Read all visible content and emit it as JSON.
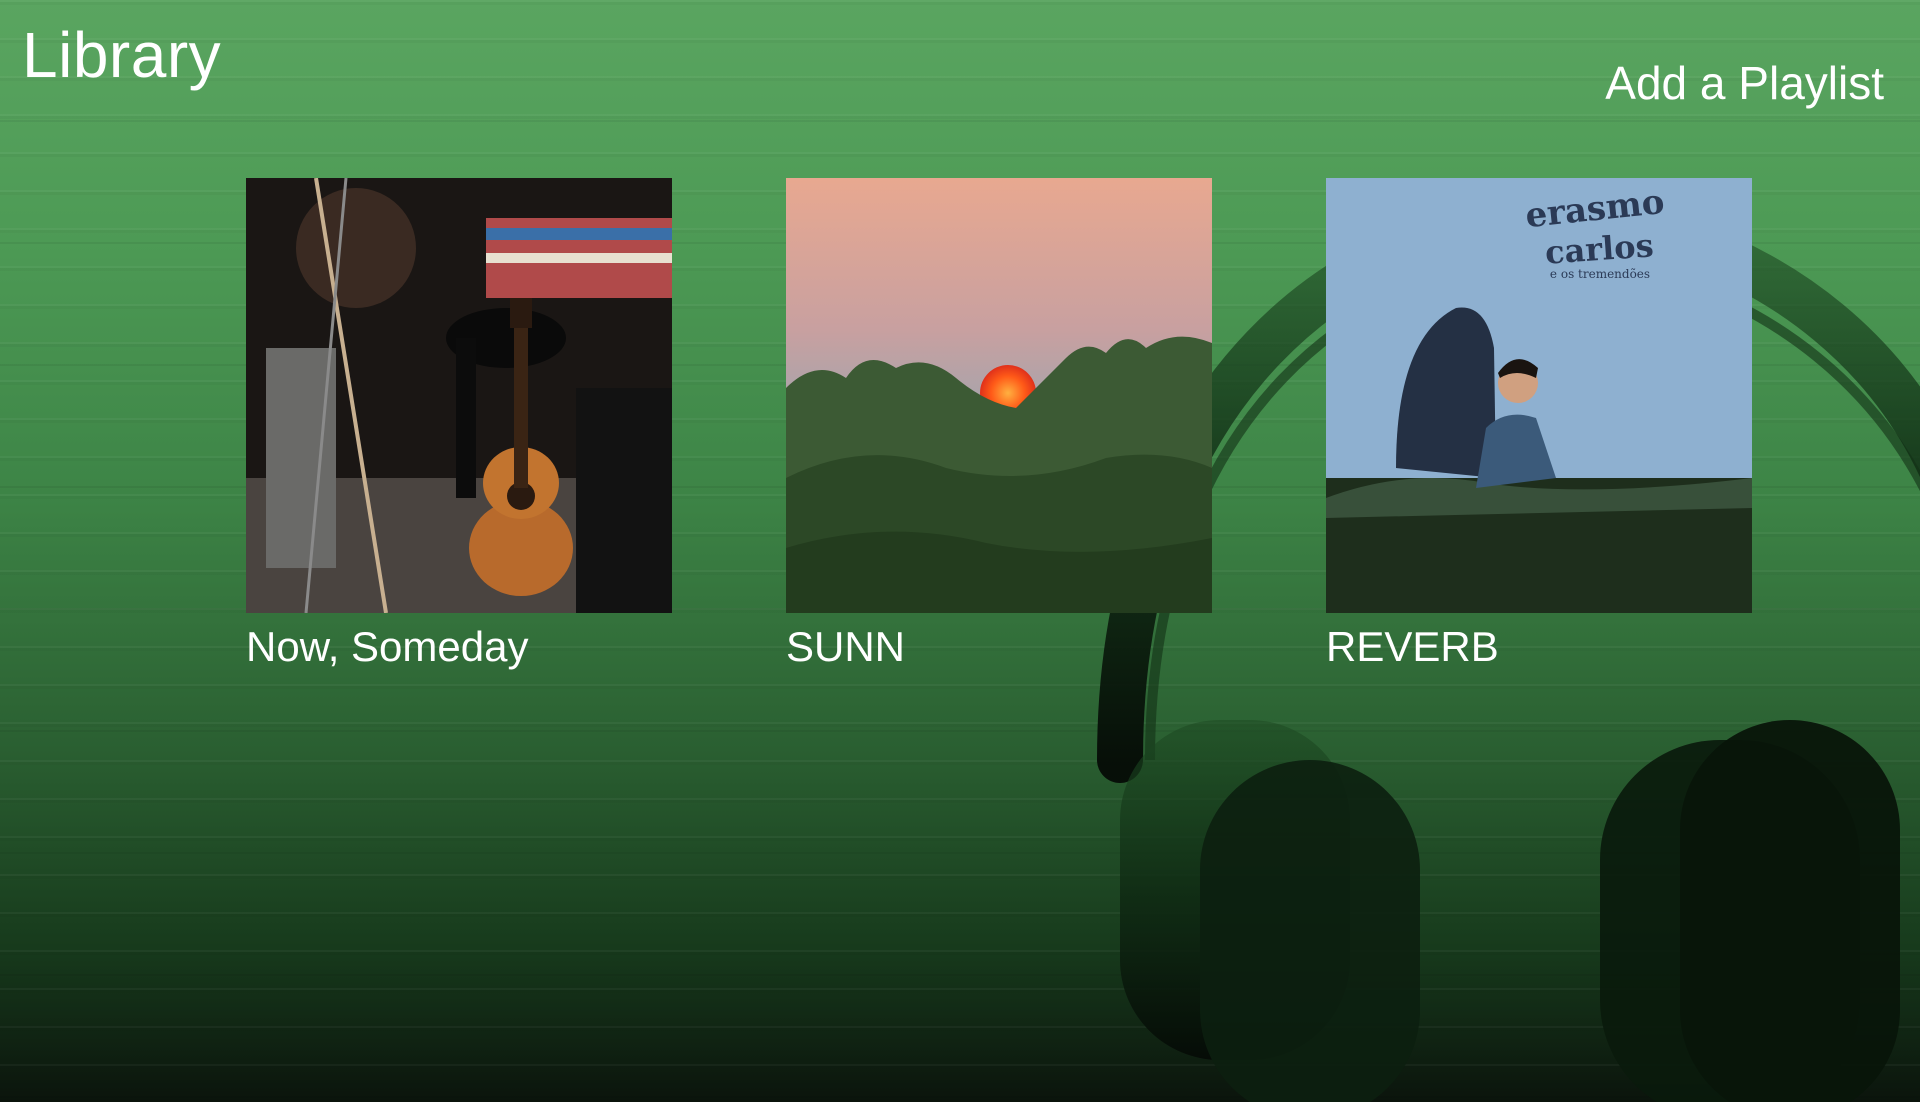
{
  "header": {
    "title": "Library",
    "add_playlist_label": "Add a Playlist"
  },
  "playlists": [
    {
      "title": "Now, Someday"
    },
    {
      "title": "SUNN"
    },
    {
      "title": "REVERB",
      "cover_text": {
        "line1": "erasmo",
        "line2": "carlos",
        "line3": "e os tremendões"
      }
    }
  ]
}
